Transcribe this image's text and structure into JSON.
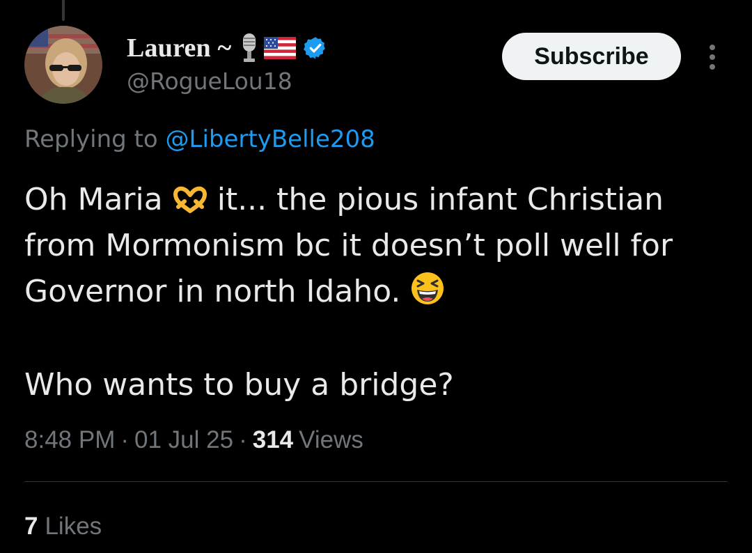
{
  "author": {
    "display_name": "Lauren ~",
    "handle": "@RogueLou18",
    "name_icons": [
      "microphone-icon",
      "us-flag-icon",
      "verified-badge-icon"
    ],
    "verified_color": "#1d9bf0"
  },
  "actions": {
    "subscribe_label": "Subscribe",
    "more_icon": "more-vertical-icon"
  },
  "reply_context": {
    "prefix": "Replying to",
    "mention": "@LibertyBelle208"
  },
  "tweet": {
    "line1_before": "Oh Maria",
    "line1_emoji": "heart-hands-emoji",
    "line1_after": "it... the pious infant Christian",
    "line2": "from Mormonism bc it doesn’t poll well for",
    "line3": "Governor in north Idaho.",
    "line3_emoji": "grinning-squinting-face-emoji",
    "line4": "Who wants to buy a bridge?"
  },
  "meta": {
    "time": "8:48 PM",
    "separator": "·",
    "date": "01 Jul 25",
    "views_count": "314",
    "views_label": "Views"
  },
  "engagement": {
    "likes_count": "7",
    "likes_label": "Likes"
  },
  "colors": {
    "background": "#000000",
    "text_primary": "#e7e9ea",
    "text_secondary": "#71767b",
    "accent": "#1d9bf0",
    "divider": "#2f3336",
    "button_bg": "#eff3f4"
  }
}
